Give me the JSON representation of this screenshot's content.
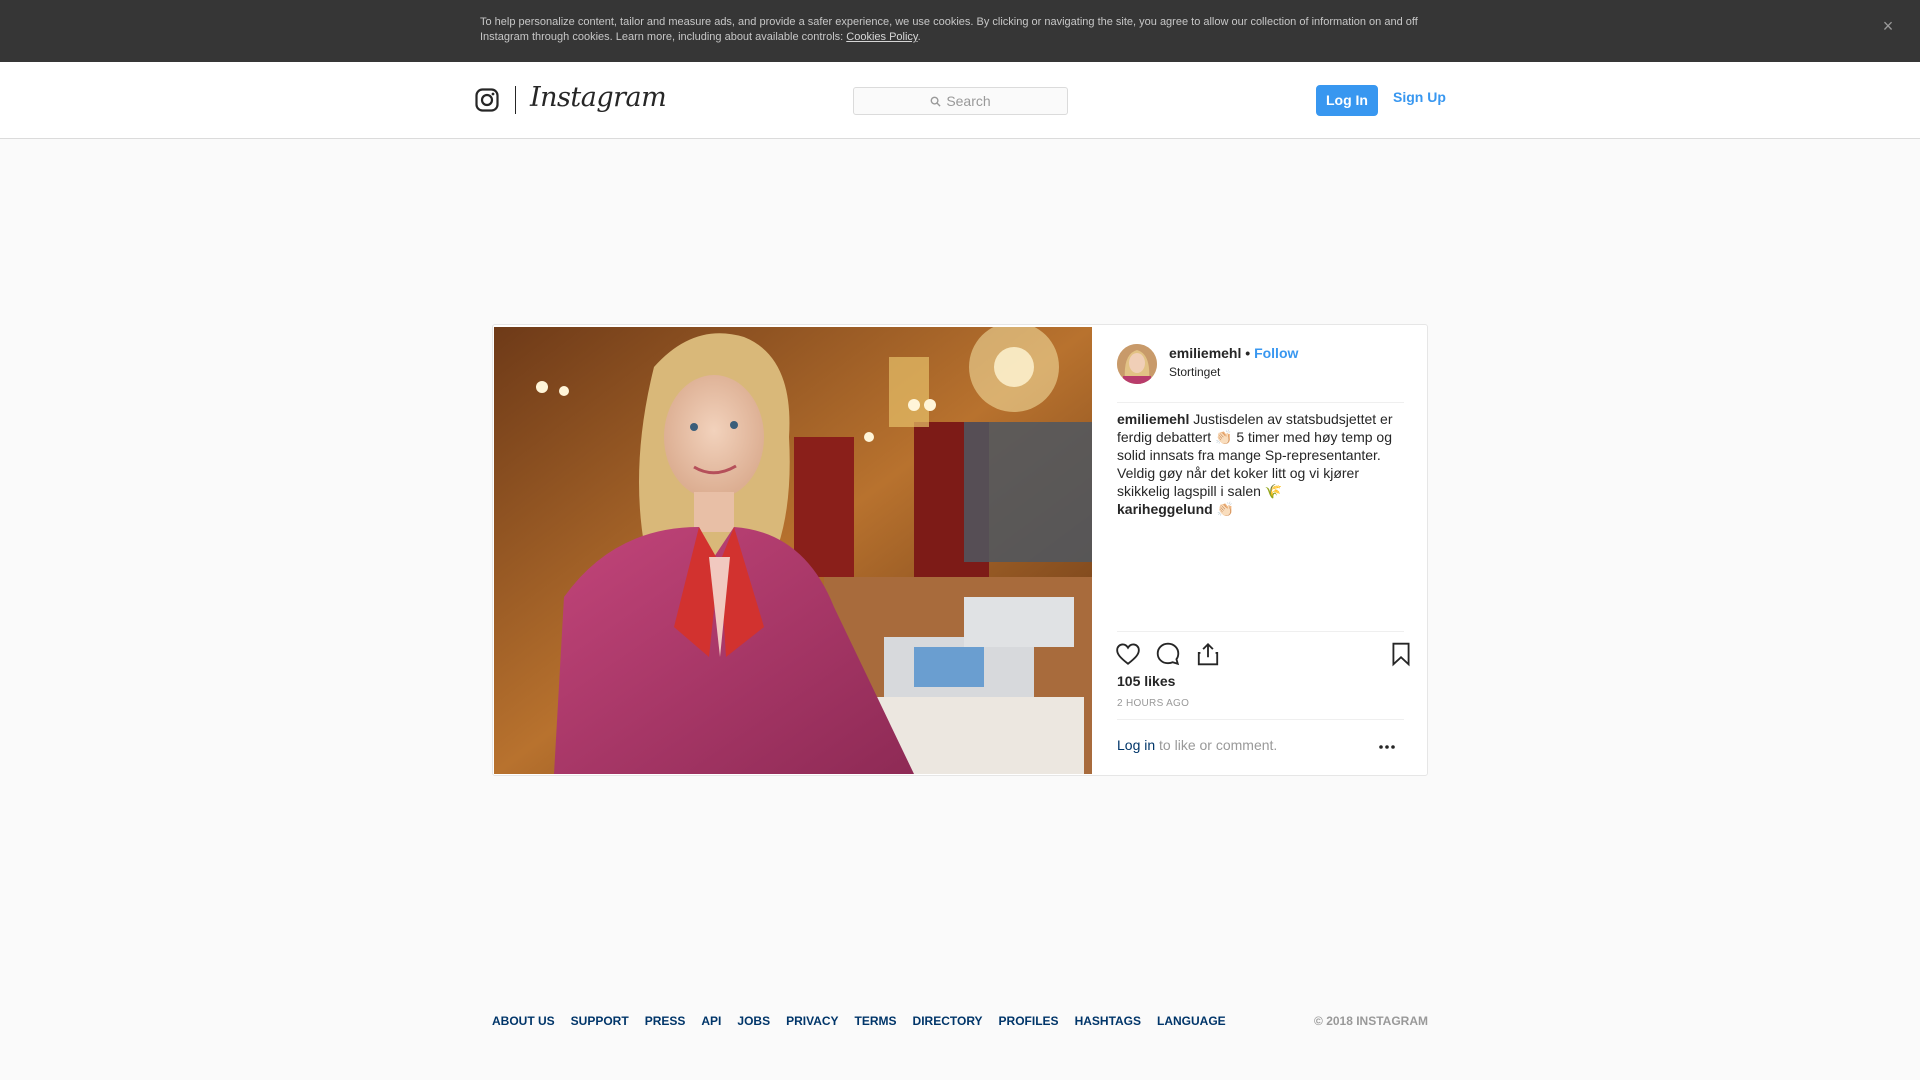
{
  "cookie_banner": {
    "text": "To help personalize content, tailor and measure ads, and provide a safer experience, we use cookies. By clicking or navigating the site, you agree to allow our collection of information on and off Instagram through cookies. Learn more, including about available controls: ",
    "link_label": "Cookies Policy",
    "trailing": ".",
    "close_glyph": "×"
  },
  "nav": {
    "wordmark": "Instagram",
    "search_placeholder": "Search",
    "login_label": "Log In",
    "signup_label": "Sign Up"
  },
  "post": {
    "username": "emiliemehl",
    "separator": " • ",
    "follow_label": "Follow",
    "location": "Stortinget",
    "caption_username": "emiliemehl",
    "caption_text": " Justisdelen av statsbudsjettet er ferdig debattert 👏🏻 5 timer med høy temp og solid innsats fra mange Sp-representanter. Veldig gøy når det koker litt og vi kjører skikkelig lagspill i salen 🌾",
    "mention": "kariheggelund",
    "mention_emoji": " 👏🏻",
    "likes": "105 likes",
    "time_ago": "2 HOURS AGO",
    "login_link": "Log in",
    "login_rest": " to like or comment."
  },
  "footer": {
    "links": [
      "ABOUT US",
      "SUPPORT",
      "PRESS",
      "API",
      "JOBS",
      "PRIVACY",
      "TERMS",
      "DIRECTORY",
      "PROFILES",
      "HASHTAGS",
      "LANGUAGE"
    ],
    "copyright": "© 2018 INSTAGRAM"
  },
  "colors": {
    "accent": "#3897f0",
    "link_dark": "#003569",
    "banner_bg": "#363636"
  }
}
